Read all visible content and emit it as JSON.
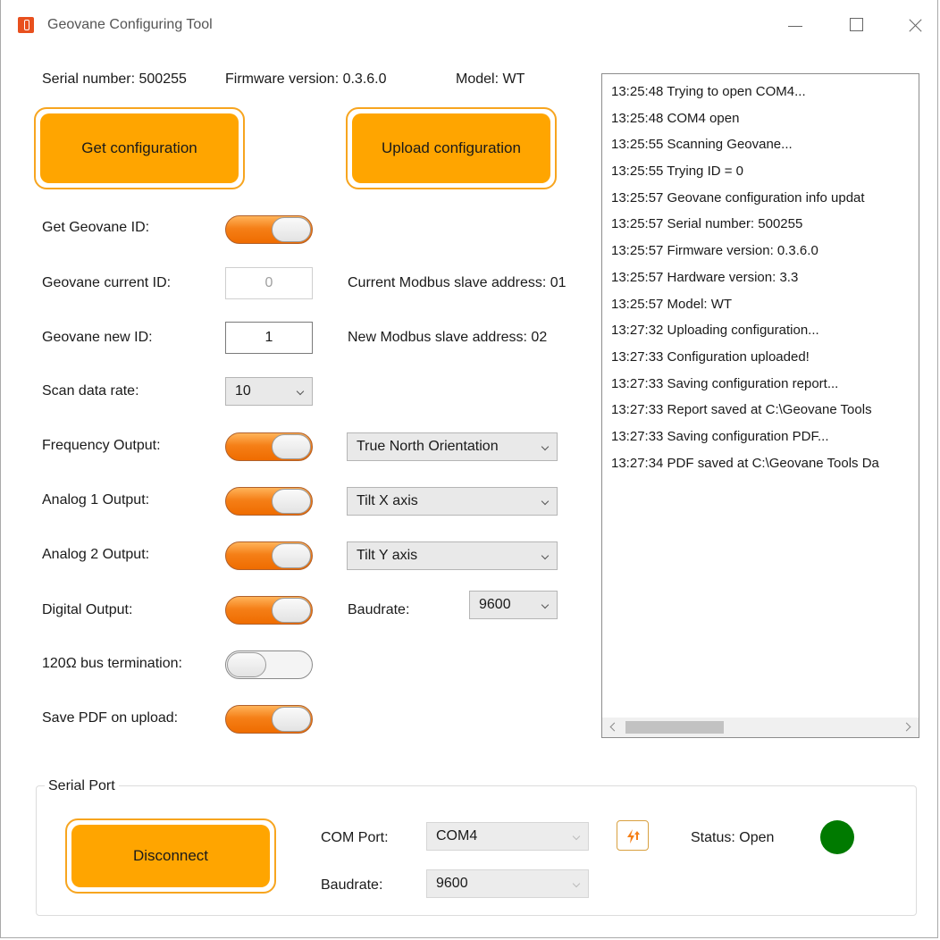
{
  "window": {
    "title": "Geovane Configuring Tool"
  },
  "info": {
    "serial": "Serial number: 500255",
    "firmware": "Firmware version: 0.3.6.0",
    "model": "Model: WT"
  },
  "buttons": {
    "get_config": "Get configuration",
    "upload_config": "Upload configuration",
    "disconnect": "Disconnect"
  },
  "settings": {
    "get_id_label": "Get Geovane ID:",
    "current_id_label": "Geovane current ID:",
    "current_id_value": "0",
    "current_modbus": "Current Modbus slave address: 01",
    "new_id_label": "Geovane new ID:",
    "new_id_value": "1",
    "new_modbus": "New Modbus slave address: 02",
    "scan_rate_label": "Scan data rate:",
    "scan_rate_value": "10",
    "freq_label": "Frequency Output:",
    "freq_value": "True North Orientation",
    "analog1_label": "Analog 1 Output:",
    "analog1_value": "Tilt X axis",
    "analog2_label": "Analog 2 Output:",
    "analog2_value": "Tilt Y axis",
    "digital_label": "Digital Output:",
    "digital_baud_label": "Baudrate:",
    "digital_baud_value": "9600",
    "termination_label": "120Ω bus termination:",
    "save_pdf_label": "Save PDF on upload:"
  },
  "toggles": {
    "get_id": true,
    "frequency": true,
    "analog1": true,
    "analog2": true,
    "digital": true,
    "termination": false,
    "save_pdf": true
  },
  "log": [
    "13:25:48 Trying to open COM4...",
    "13:25:48 COM4 open",
    "13:25:55 Scanning Geovane...",
    "13:25:55 Trying ID = 0",
    "13:25:57 Geovane configuration info updat",
    "13:25:57 Serial number: 500255",
    "13:25:57 Firmware version: 0.3.6.0",
    "13:25:57 Hardware version: 3.3",
    "13:25:57 Model: WT",
    "13:27:32 Uploading configuration...",
    "13:27:33 Configuration uploaded!",
    "13:27:33 Saving configuration report...",
    "13:27:33 Report saved at C:\\Geovane Tools",
    "13:27:33 Saving configuration PDF...",
    "13:27:34 PDF saved at C:\\Geovane Tools Da"
  ],
  "serial_port": {
    "group_label": "Serial Port",
    "com_label": "COM Port:",
    "com_value": "COM4",
    "baud_label": "Baudrate:",
    "baud_value": "9600",
    "status": "Status: Open",
    "status_color": "#007a00"
  },
  "colors": {
    "accent": "#ffa500",
    "toggle_on": "#f57f17"
  }
}
